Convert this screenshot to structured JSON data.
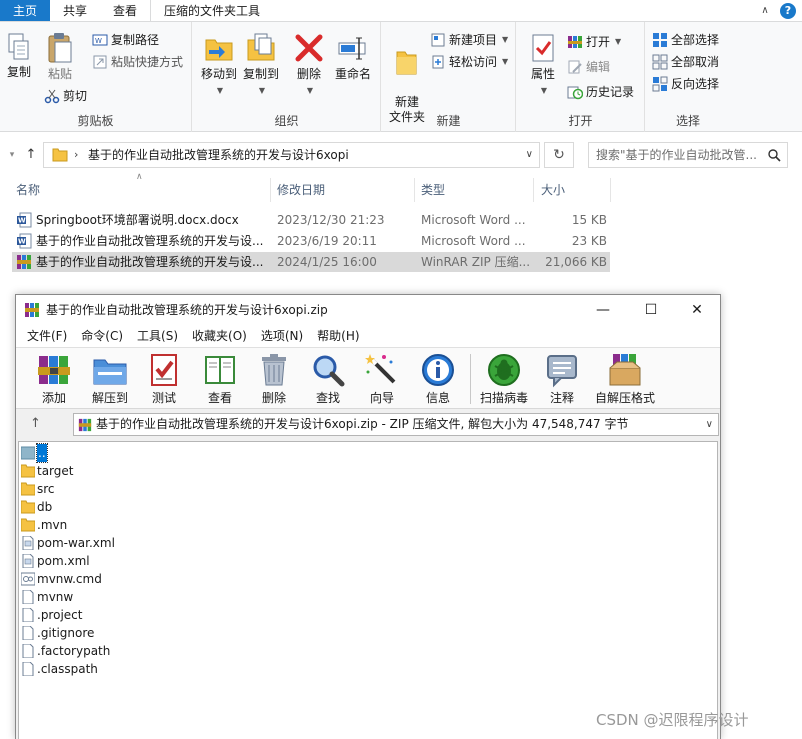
{
  "ribbon": {
    "tabs": [
      "主页",
      "共享",
      "查看",
      "压缩的文件夹工具"
    ],
    "groups": {
      "clipboard": {
        "label": "剪贴板",
        "copy": "复制",
        "paste": "粘贴",
        "copy_path": "复制路径",
        "paste_shortcut": "粘贴快捷方式",
        "cut": "剪切"
      },
      "organize": {
        "label": "组织",
        "move_to": "移动到",
        "copy_to": "复制到",
        "delete": "删除",
        "rename": "重命名"
      },
      "new": {
        "label": "新建",
        "new_folder": "新建\n文件夹",
        "new_item": "新建项目",
        "easy_access": "轻松访问"
      },
      "open": {
        "label": "打开",
        "properties": "属性",
        "open": "打开",
        "edit": "编辑",
        "history": "历史记录"
      },
      "select": {
        "label": "选择",
        "select_all": "全部选择",
        "select_none": "全部取消",
        "invert": "反向选择"
      }
    }
  },
  "address": {
    "path": "基于的作业自动批改管理系统的开发与设计6xopi",
    "search_placeholder": "搜索\"基于的作业自动批改管..."
  },
  "file_list": {
    "columns": [
      "名称",
      "修改日期",
      "类型",
      "大小"
    ],
    "rows": [
      {
        "name": "Springboot环境部署说明.docx.docx",
        "date": "2023/12/30 21:23",
        "type": "Microsoft Word ...",
        "size": "15 KB",
        "icon": "word-doc-icon"
      },
      {
        "name": "基于的作业自动批改管理系统的开发与设...",
        "date": "2023/6/19 20:11",
        "type": "Microsoft Word ...",
        "size": "23 KB",
        "icon": "word-doc-icon"
      },
      {
        "name": "基于的作业自动批改管理系统的开发与设...",
        "date": "2024/1/25 16:00",
        "type": "WinRAR ZIP 压缩...",
        "size": "21,066 KB",
        "icon": "winrar-zip-icon"
      }
    ]
  },
  "winrar": {
    "title": "基于的作业自动批改管理系统的开发与设计6xopi.zip",
    "menu": [
      "文件(F)",
      "命令(C)",
      "工具(S)",
      "收藏夹(O)",
      "选项(N)",
      "帮助(H)"
    ],
    "toolbar": [
      "添加",
      "解压到",
      "测试",
      "查看",
      "删除",
      "查找",
      "向导",
      "信息",
      "扫描病毒",
      "注释",
      "自解压格式"
    ],
    "path_text": "基于的作业自动批改管理系统的开发与设计6xopi.zip - ZIP 压缩文件, 解包大小为 47,548,747 字节",
    "items": [
      {
        "name": "..",
        "kind": "parent"
      },
      {
        "name": "target",
        "kind": "folder"
      },
      {
        "name": "src",
        "kind": "folder"
      },
      {
        "name": "db",
        "kind": "folder"
      },
      {
        "name": ".mvn",
        "kind": "folder"
      },
      {
        "name": "pom-war.xml",
        "kind": "xml"
      },
      {
        "name": "pom.xml",
        "kind": "xml"
      },
      {
        "name": "mvnw.cmd",
        "kind": "cmd"
      },
      {
        "name": "mvnw",
        "kind": "file"
      },
      {
        "name": ".project",
        "kind": "file"
      },
      {
        "name": ".gitignore",
        "kind": "file"
      },
      {
        "name": ".factorypath",
        "kind": "file"
      },
      {
        "name": ".classpath",
        "kind": "file"
      }
    ]
  },
  "watermark": "CSDN @迟限程序设计",
  "colors": {
    "accent": "#1979ca",
    "selection_gray": "#d9d9d9",
    "winrar_selection": "#0078d7",
    "folder_yellow": "#f5c242"
  }
}
